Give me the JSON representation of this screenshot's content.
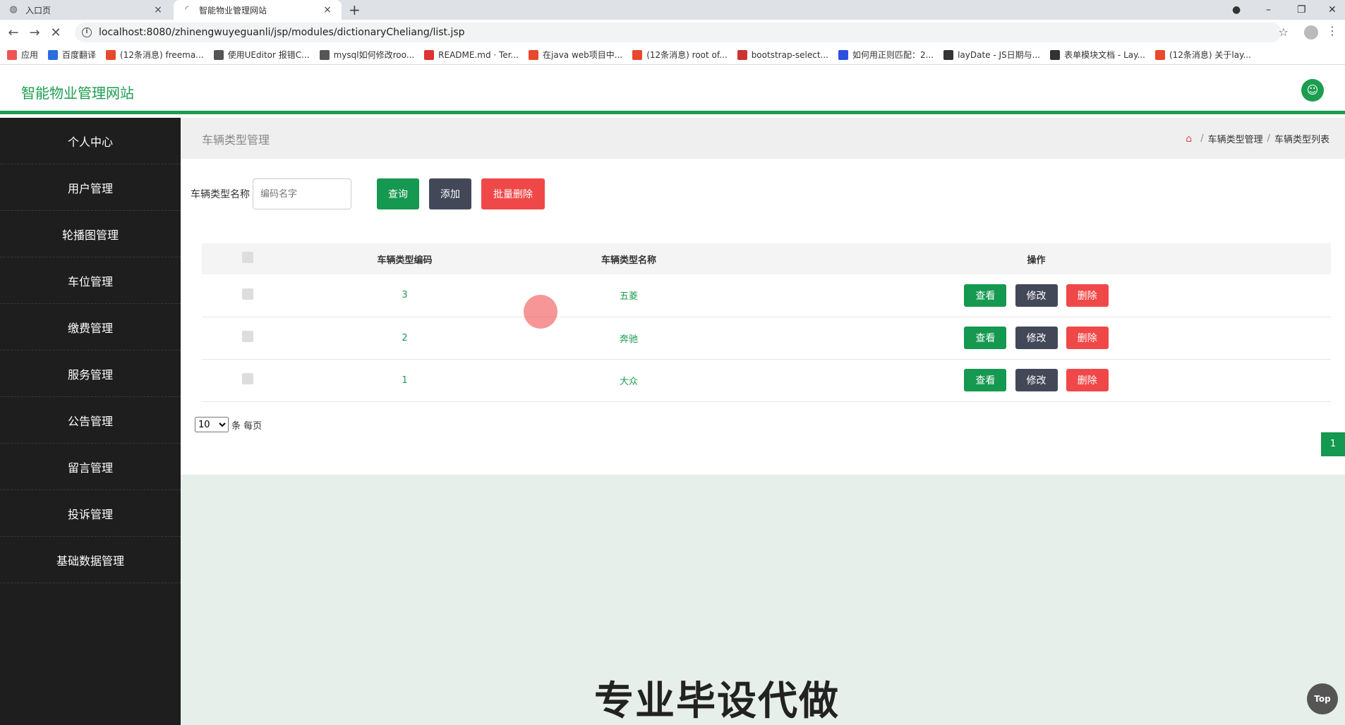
{
  "browser": {
    "tabs": [
      {
        "title": "入口页",
        "close": "×"
      },
      {
        "title": "智能物业管理网站",
        "close": "×"
      }
    ],
    "new_tab": "+",
    "url": "localhost:8080/zhinengwuyeguanli/jsp/modules/dictionaryCheliang/list.jsp",
    "bookmarks": [
      {
        "label": "应用",
        "color": "#e55"
      },
      {
        "label": "百度翻译",
        "color": "#2b6de0"
      },
      {
        "label": "(12条消息) freema...",
        "color": "#e8482b"
      },
      {
        "label": "使用UEditor 报错C...",
        "color": "#555"
      },
      {
        "label": "mysql如何修改roo...",
        "color": "#555"
      },
      {
        "label": "README.md · Ter...",
        "color": "#d33"
      },
      {
        "label": "在java web项目中...",
        "color": "#e8482b"
      },
      {
        "label": "(12条消息) root of...",
        "color": "#e8482b"
      },
      {
        "label": "bootstrap-select...",
        "color": "#c33"
      },
      {
        "label": "如何用正则匹配：2...",
        "color": "#2b4fe0"
      },
      {
        "label": "layDate - JS日期与...",
        "color": "#333"
      },
      {
        "label": "表单模块文档 - Lay...",
        "color": "#333"
      },
      {
        "label": "(12条消息) 关于lay...",
        "color": "#e8482b"
      }
    ]
  },
  "app": {
    "title": "智能物业管理网站",
    "accent": "#1c9d4f"
  },
  "sidebar": {
    "items": [
      {
        "label": "个人中心"
      },
      {
        "label": "用户管理"
      },
      {
        "label": "轮播图管理"
      },
      {
        "label": "车位管理"
      },
      {
        "label": "缴费管理"
      },
      {
        "label": "服务管理"
      },
      {
        "label": "公告管理"
      },
      {
        "label": "留言管理"
      },
      {
        "label": "投诉管理"
      },
      {
        "label": "基础数据管理"
      }
    ]
  },
  "page": {
    "title": "车辆类型管理",
    "breadcrumb": [
      "车辆类型管理",
      "车辆类型列表"
    ]
  },
  "search": {
    "label": "车辆类型名称",
    "placeholder": "编码名字",
    "search_button": "查询",
    "add_button": "添加",
    "batch_delete_button": "批量删除"
  },
  "table": {
    "headers": [
      "车辆类型编码",
      "车辆类型名称",
      "操作"
    ],
    "rows": [
      {
        "code": "3",
        "name": "五菱"
      },
      {
        "code": "2",
        "name": "奔驰"
      },
      {
        "code": "1",
        "name": "大众"
      }
    ],
    "actions": {
      "view": "查看",
      "edit": "修改",
      "delete": "删除"
    }
  },
  "pager": {
    "page_size": "10",
    "page_size_suffix": "条 每页",
    "current_page": "1"
  },
  "watermark": "专业毕设代做",
  "top_button": "Top"
}
